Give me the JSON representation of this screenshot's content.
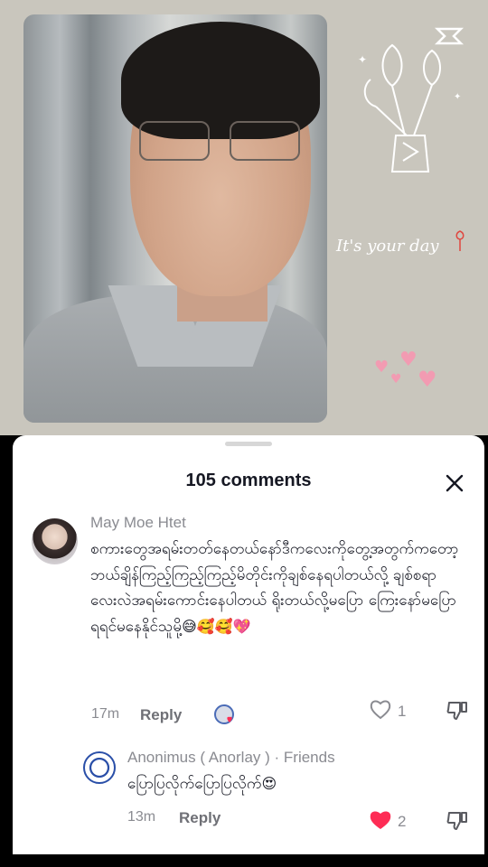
{
  "video": {
    "caption_script": "It's your day",
    "caption_small": "…",
    "brand_icon": "capcut-icon"
  },
  "comments_sheet": {
    "title": "105 comments",
    "close_icon": "close-icon",
    "comments": [
      {
        "username": "May Moe Htet",
        "text": "စကားတွေအရမ်းတတ်နေတယ်နော်ဒီကလေးကိုတွေ့အတွက်ကတော့ဘယ်ချိန်ကြည့်ကြည့်ကြည့်မိတိုင်းကိုချစ်နေရပါတယ်လို့ ချစ်စရာလေးလဲအရမ်းကောင်းနေပါတယ် ရိုးတယ်လို့မပြော ကြေးနော်မပြောရရင်မနေနိုင်သူမို့",
        "emojis": "😅🥰🥰💖",
        "time": "17m",
        "reply_label": "Reply",
        "likes": "1",
        "liked": false
      },
      {
        "username": "Anonimus ( Anorlay ) · Friends",
        "text": "ပြောပြလိုက်ပြောပြလိုက်",
        "emojis": "😍",
        "time": "13m",
        "reply_label": "Reply",
        "likes": "2",
        "liked": true
      }
    ]
  },
  "colors": {
    "accent_like": "#fe2c55",
    "secondary_text": "#8a8b91",
    "primary_text": "#161823"
  }
}
